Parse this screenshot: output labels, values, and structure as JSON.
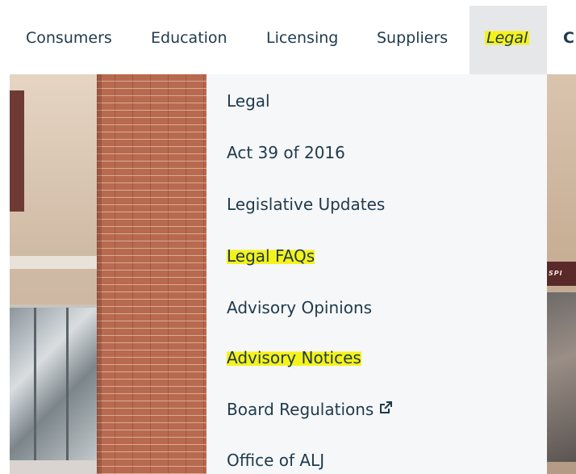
{
  "nav": {
    "items": [
      {
        "label": "Consumers"
      },
      {
        "label": "Education"
      },
      {
        "label": "Licensing"
      },
      {
        "label": "Suppliers"
      }
    ],
    "active": {
      "label": "Legal"
    },
    "next_partial": "C"
  },
  "dropdown": {
    "items": [
      {
        "label": "Legal",
        "highlighted": false
      },
      {
        "label": "Act 39 of 2016",
        "highlighted": false
      },
      {
        "label": "Legislative Updates",
        "highlighted": false
      },
      {
        "label": "Legal FAQs",
        "highlighted": true
      },
      {
        "label": "Advisory Opinions",
        "highlighted": false
      },
      {
        "label": "Advisory Notices",
        "highlighted": true
      },
      {
        "label": "Board Regulations",
        "highlighted": false,
        "icon": "external-link-icon"
      },
      {
        "label": "Office of ALJ",
        "highlighted": false
      }
    ]
  },
  "hero": {
    "sign_text_partial": "SPI"
  },
  "colors": {
    "nav_text": "#1f3a4d",
    "active_bg": "#e6e7e8",
    "dropdown_bg": "#f6f7f8",
    "highlight": "#f5f21b"
  }
}
